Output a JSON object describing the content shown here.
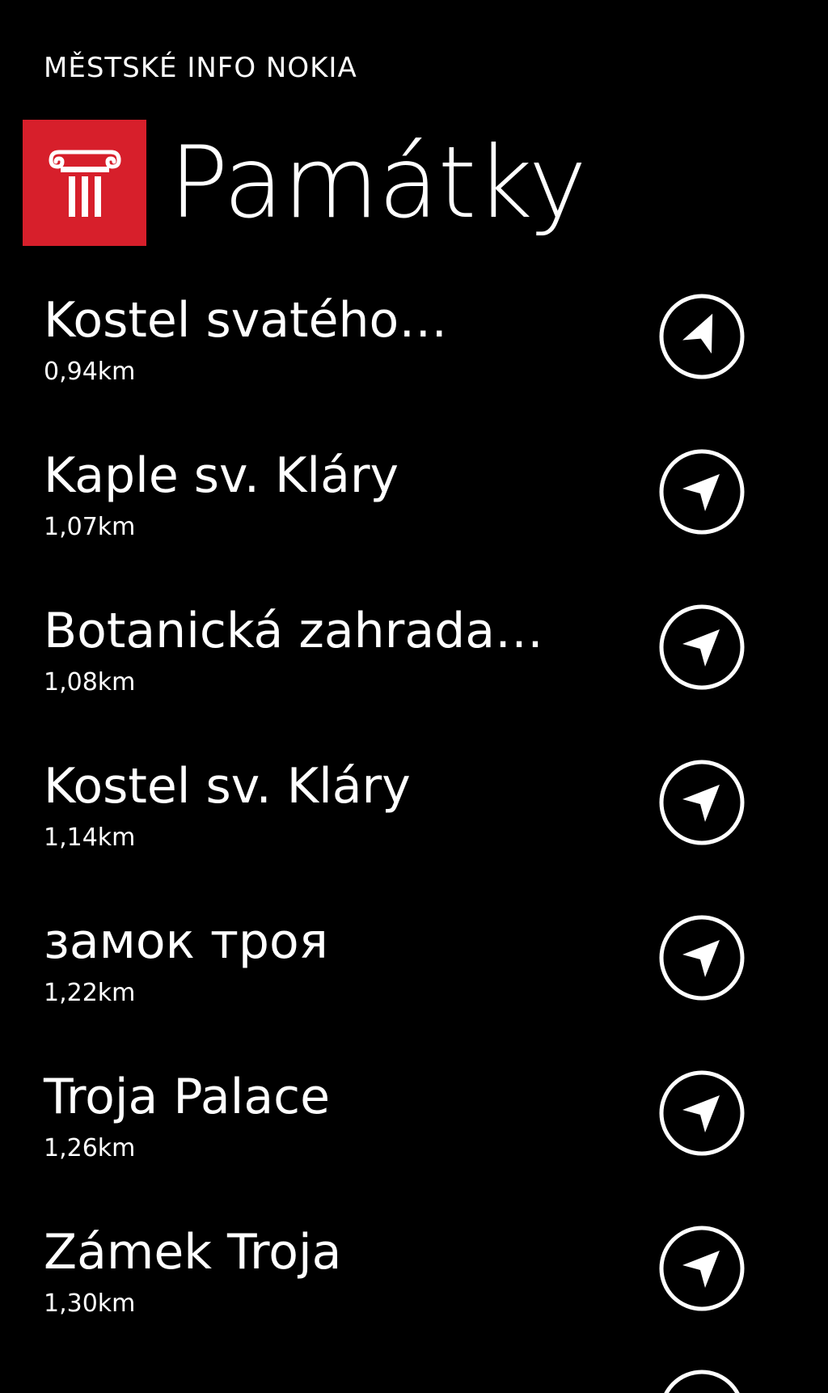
{
  "app": {
    "title": "MĚSTSKÉ INFO NOKIA"
  },
  "header": {
    "icon": "column-icon",
    "tile_color": "#d71f2b",
    "title": "Památky"
  },
  "places": [
    {
      "name": "Kostel svatého…",
      "distance": "0,94km"
    },
    {
      "name": "Kaple sv. Kláry",
      "distance": "1,07km"
    },
    {
      "name": "Botanická zahrada…",
      "distance": "1,08km"
    },
    {
      "name": "Kostel sv. Kláry",
      "distance": "1,14km"
    },
    {
      "name": "замок троя",
      "distance": "1,22km"
    },
    {
      "name": "Troja Palace",
      "distance": "1,26km"
    },
    {
      "name": "Zámek Troja",
      "distance": "1,30km"
    }
  ],
  "navigate_icon": "navigate-arrow-icon"
}
